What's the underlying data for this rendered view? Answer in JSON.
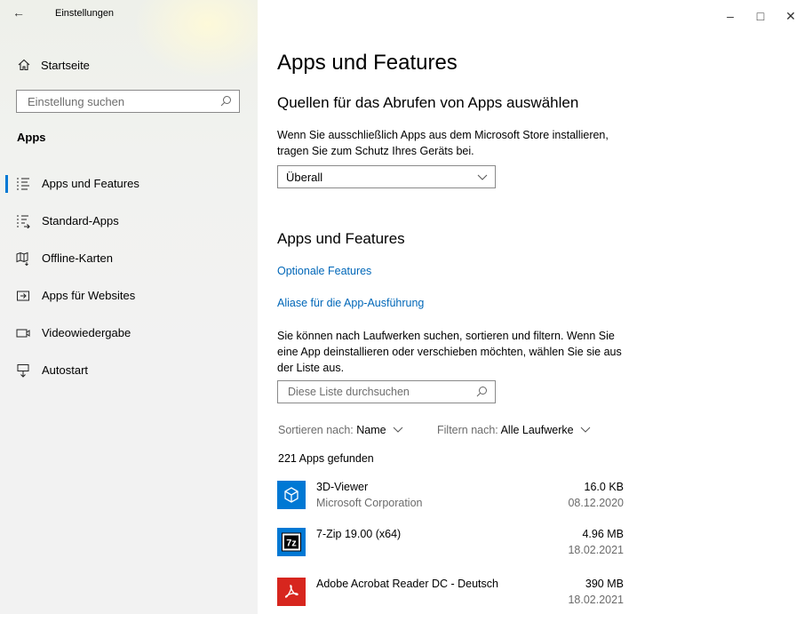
{
  "window": {
    "title": "Einstellungen",
    "back_icon": "←",
    "minimize_icon": "–",
    "maximize_icon": "□",
    "close_icon": "✕"
  },
  "sidebar": {
    "home_label": "Startseite",
    "search_placeholder": "Einstellung suchen",
    "section_title": "Apps",
    "items": [
      {
        "label": "Apps und Features",
        "icon": "list-icon",
        "active": true
      },
      {
        "label": "Standard-Apps",
        "icon": "default-apps-icon",
        "active": false
      },
      {
        "label": "Offline-Karten",
        "icon": "map-icon",
        "active": false
      },
      {
        "label": "Apps für Websites",
        "icon": "web-app-icon",
        "active": false
      },
      {
        "label": "Videowiedergabe",
        "icon": "video-icon",
        "active": false
      },
      {
        "label": "Autostart",
        "icon": "startup-icon",
        "active": false
      }
    ]
  },
  "main": {
    "page_title": "Apps und Features",
    "source_heading": "Quellen für das Abrufen von Apps auswählen",
    "source_desc": "Wenn Sie ausschließlich Apps aus dem Microsoft Store installieren, tragen Sie zum Schutz Ihres Geräts bei.",
    "source_select_value": "Überall",
    "features_heading": "Apps und Features",
    "link_optional": "Optionale Features",
    "link_alias": "Aliase für die App-Ausführung",
    "list_desc": "Sie können nach Laufwerken suchen, sortieren und filtern. Wenn Sie eine App deinstallieren oder verschieben möchten, wählen Sie sie aus der Liste aus.",
    "list_search_placeholder": "Diese Liste durchsuchen",
    "sort_label": "Sortieren nach:",
    "sort_value": "Name",
    "filter_label": "Filtern nach:",
    "filter_value": "Alle Laufwerke",
    "app_count": "221 Apps gefunden",
    "apps": [
      {
        "name": "3D-Viewer",
        "publisher": "Microsoft Corporation",
        "size": "16.0 KB",
        "date": "08.12.2020",
        "icon": "3d-viewer-icon",
        "color": "#0078d4"
      },
      {
        "name": "7-Zip 19.00 (x64)",
        "publisher": "",
        "size": "4.96 MB",
        "date": "18.02.2021",
        "icon": "7zip-icon",
        "color": "#0078d4"
      },
      {
        "name": "Adobe Acrobat Reader DC - Deutsch",
        "publisher": "",
        "size": "390 MB",
        "date": "18.02.2021",
        "icon": "acrobat-icon",
        "color": "#d7261e"
      }
    ]
  },
  "colors": {
    "accent": "#0078d4",
    "link": "#0067b8",
    "sidebar_bg": "#f2f2f2"
  }
}
